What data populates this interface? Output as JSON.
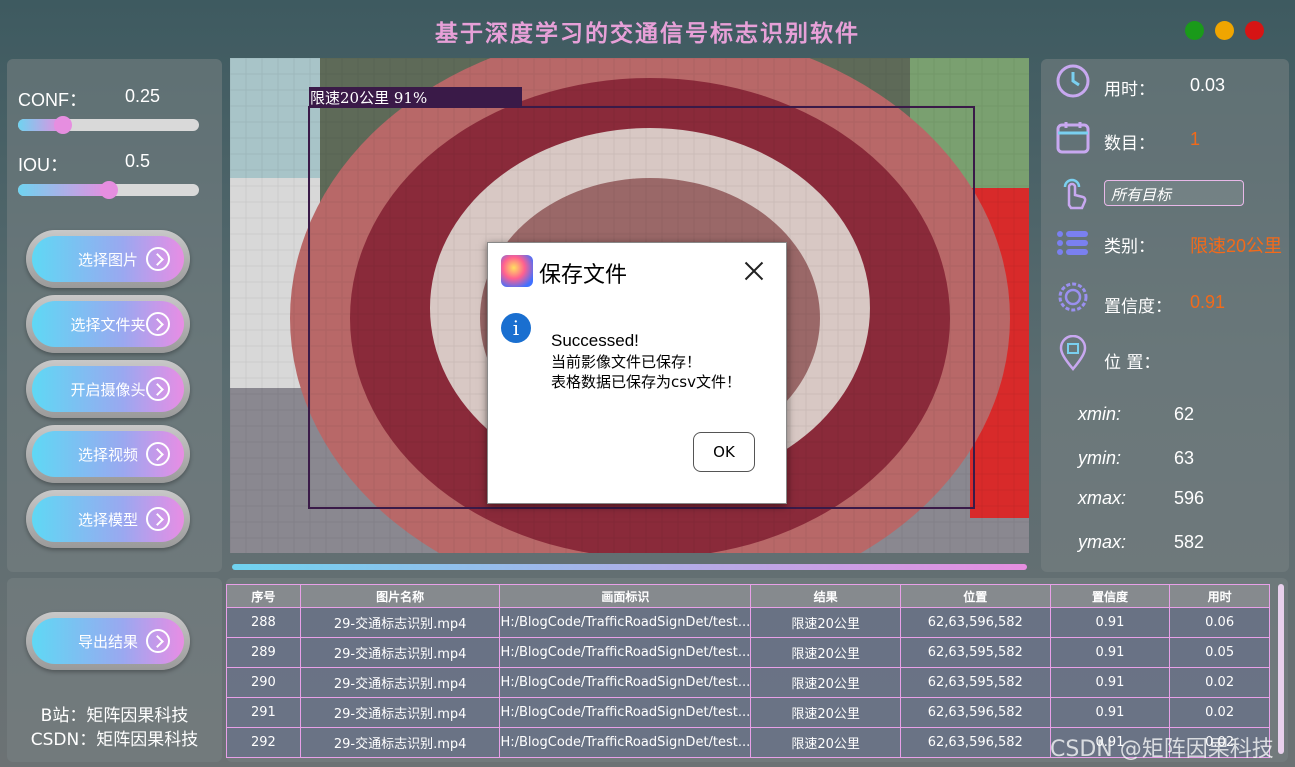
{
  "app": {
    "title": "基于深度学习的交通信号标志识别软件",
    "window_controls": [
      "green",
      "yellow",
      "red"
    ]
  },
  "params": {
    "conf": {
      "label": "CONF：",
      "value": "0.25",
      "fraction": 0.25
    },
    "iou": {
      "label": "IOU：",
      "value": "0.5",
      "fraction": 0.5
    }
  },
  "buttons": {
    "select_image": "选择图片",
    "select_folder": "选择文件夹",
    "open_camera": "开启摄像头",
    "select_video": "选择视频",
    "select_model": "选择模型",
    "export_results": "导出结果"
  },
  "credits": {
    "bilibili": "B站：矩阵因果科技",
    "csdn": "CSDN：矩阵因果科技"
  },
  "detection": {
    "label": "限速20公里  91%"
  },
  "info": {
    "time_label": "用时：",
    "time_value": "0.03",
    "count_label": "数目：",
    "count_value": "1",
    "target_select": "所有目标",
    "class_label": "类别：",
    "class_value": "限速20公里",
    "conf_label": "置信度：",
    "conf_value": "0.91",
    "position_label": "位 置：",
    "xmin_label": "xmin:",
    "xmin_value": "62",
    "ymin_label": "ymin:",
    "ymin_value": "63",
    "xmax_label": "xmax:",
    "xmax_value": "596",
    "ymax_label": "ymax:",
    "ymax_value": "582"
  },
  "table": {
    "headers": [
      "序号",
      "图片名称",
      "画面标识",
      "结果",
      "位置",
      "置信度",
      "用时"
    ],
    "rows": [
      [
        "288",
        "29-交通标志识别.mp4",
        "H:/BlogCode/TrafficRoadSignDet/test...",
        "限速20公里",
        "62,63,596,582",
        "0.91",
        "0.06"
      ],
      [
        "289",
        "29-交通标志识别.mp4",
        "H:/BlogCode/TrafficRoadSignDet/test...",
        "限速20公里",
        "62,63,595,582",
        "0.91",
        "0.05"
      ],
      [
        "290",
        "29-交通标志识别.mp4",
        "H:/BlogCode/TrafficRoadSignDet/test...",
        "限速20公里",
        "62,63,595,582",
        "0.91",
        "0.02"
      ],
      [
        "291",
        "29-交通标志识别.mp4",
        "H:/BlogCode/TrafficRoadSignDet/test...",
        "限速20公里",
        "62,63,596,582",
        "0.91",
        "0.02"
      ],
      [
        "292",
        "29-交通标志识别.mp4",
        "H:/BlogCode/TrafficRoadSignDet/test...",
        "限速20公里",
        "62,63,596,582",
        "0.91",
        "0.02"
      ]
    ]
  },
  "dialog": {
    "title": "保存文件",
    "line1": "Successed!",
    "line2": "当前影像文件已保存！",
    "line3": "表格数据已保存为csv文件！",
    "ok": "OK"
  },
  "watermark": "CSDN @矩阵因果科技"
}
